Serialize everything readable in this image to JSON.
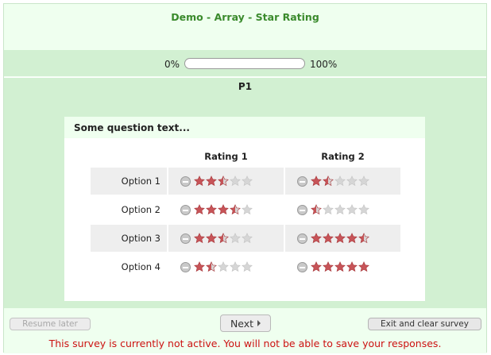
{
  "survey": {
    "title": "Demo - Array - Star Rating"
  },
  "progress": {
    "min_label": "0%",
    "max_label": "100%",
    "percent": 0
  },
  "group": {
    "name": "P1"
  },
  "question": {
    "text": "Some question text...",
    "columns": [
      "Rating 1",
      "Rating 2"
    ],
    "rows": [
      {
        "label": "Option 1",
        "ratings": [
          2.5,
          1.5
        ]
      },
      {
        "label": "Option 2",
        "ratings": [
          3.5,
          0.5
        ]
      },
      {
        "label": "Option 3",
        "ratings": [
          2.5,
          4.5
        ]
      },
      {
        "label": "Option 4",
        "ratings": [
          1.5,
          5
        ]
      }
    ],
    "max_stars": 5
  },
  "navigation": {
    "resume_label": "Resume later",
    "next_label": "Next",
    "exit_label": "Exit and clear survey"
  },
  "warning": "This survey is currently not active. You will not be able to save your responses.",
  "colors": {
    "star_filled": "#c75458",
    "star_empty": "#d6d6d6",
    "title": "#3a8a2c",
    "warning": "#cc1111"
  },
  "icons": {
    "cancel": "cancel-rating-icon",
    "star": "star-icon",
    "next_arrow": "chevron-right-icon"
  }
}
